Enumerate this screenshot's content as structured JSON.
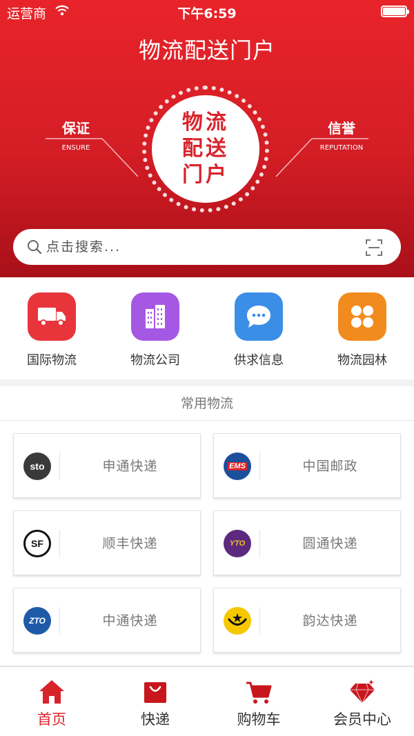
{
  "status_bar": {
    "carrier": "运营商",
    "time": "下午6:59"
  },
  "header": {
    "title": "物流配送门户",
    "emblem_lines": [
      "物流",
      "配送",
      "门户"
    ],
    "left_motto": {
      "title": "保证",
      "subtitle": "ENSURE"
    },
    "right_motto": {
      "title": "信誉",
      "subtitle": "REPUTATION"
    }
  },
  "search": {
    "placeholder": "点击搜索..."
  },
  "quick_nav": [
    {
      "label": "国际物流",
      "icon": "truck-icon",
      "color": "#e8353c"
    },
    {
      "label": "物流公司",
      "icon": "building-icon",
      "color": "#a558e3"
    },
    {
      "label": "供求信息",
      "icon": "chat-bubble-icon",
      "color": "#3b8ee6"
    },
    {
      "label": "物流园林",
      "icon": "four-petal-icon",
      "color": "#f28b1d"
    }
  ],
  "common_logistics": {
    "title": "常用物流",
    "carriers": [
      {
        "name": "申通快递",
        "logo": "sto-logo",
        "logo_text": "sto"
      },
      {
        "name": "中国邮政",
        "logo": "ems-logo",
        "logo_text": "EMS"
      },
      {
        "name": "顺丰快递",
        "logo": "sf-logo",
        "logo_text": "SF"
      },
      {
        "name": "圆通快递",
        "logo": "yto-logo",
        "logo_text": "YTO"
      },
      {
        "name": "中通快递",
        "logo": "zto-logo",
        "logo_text": "ZTO"
      },
      {
        "name": "韵达快递",
        "logo": "yunda-logo",
        "logo_text": ""
      }
    ]
  },
  "tab_bar": [
    {
      "label": "首页",
      "icon": "home-icon",
      "active": true
    },
    {
      "label": "快递",
      "icon": "shopping-bag-icon",
      "active": false
    },
    {
      "label": "购物车",
      "icon": "cart-icon",
      "active": false
    },
    {
      "label": "会员中心",
      "icon": "diamond-icon",
      "active": false
    }
  ],
  "colors": {
    "brand_red": "#d9232b",
    "hero_top": "#e8242a",
    "hero_bottom": "#a81019"
  }
}
